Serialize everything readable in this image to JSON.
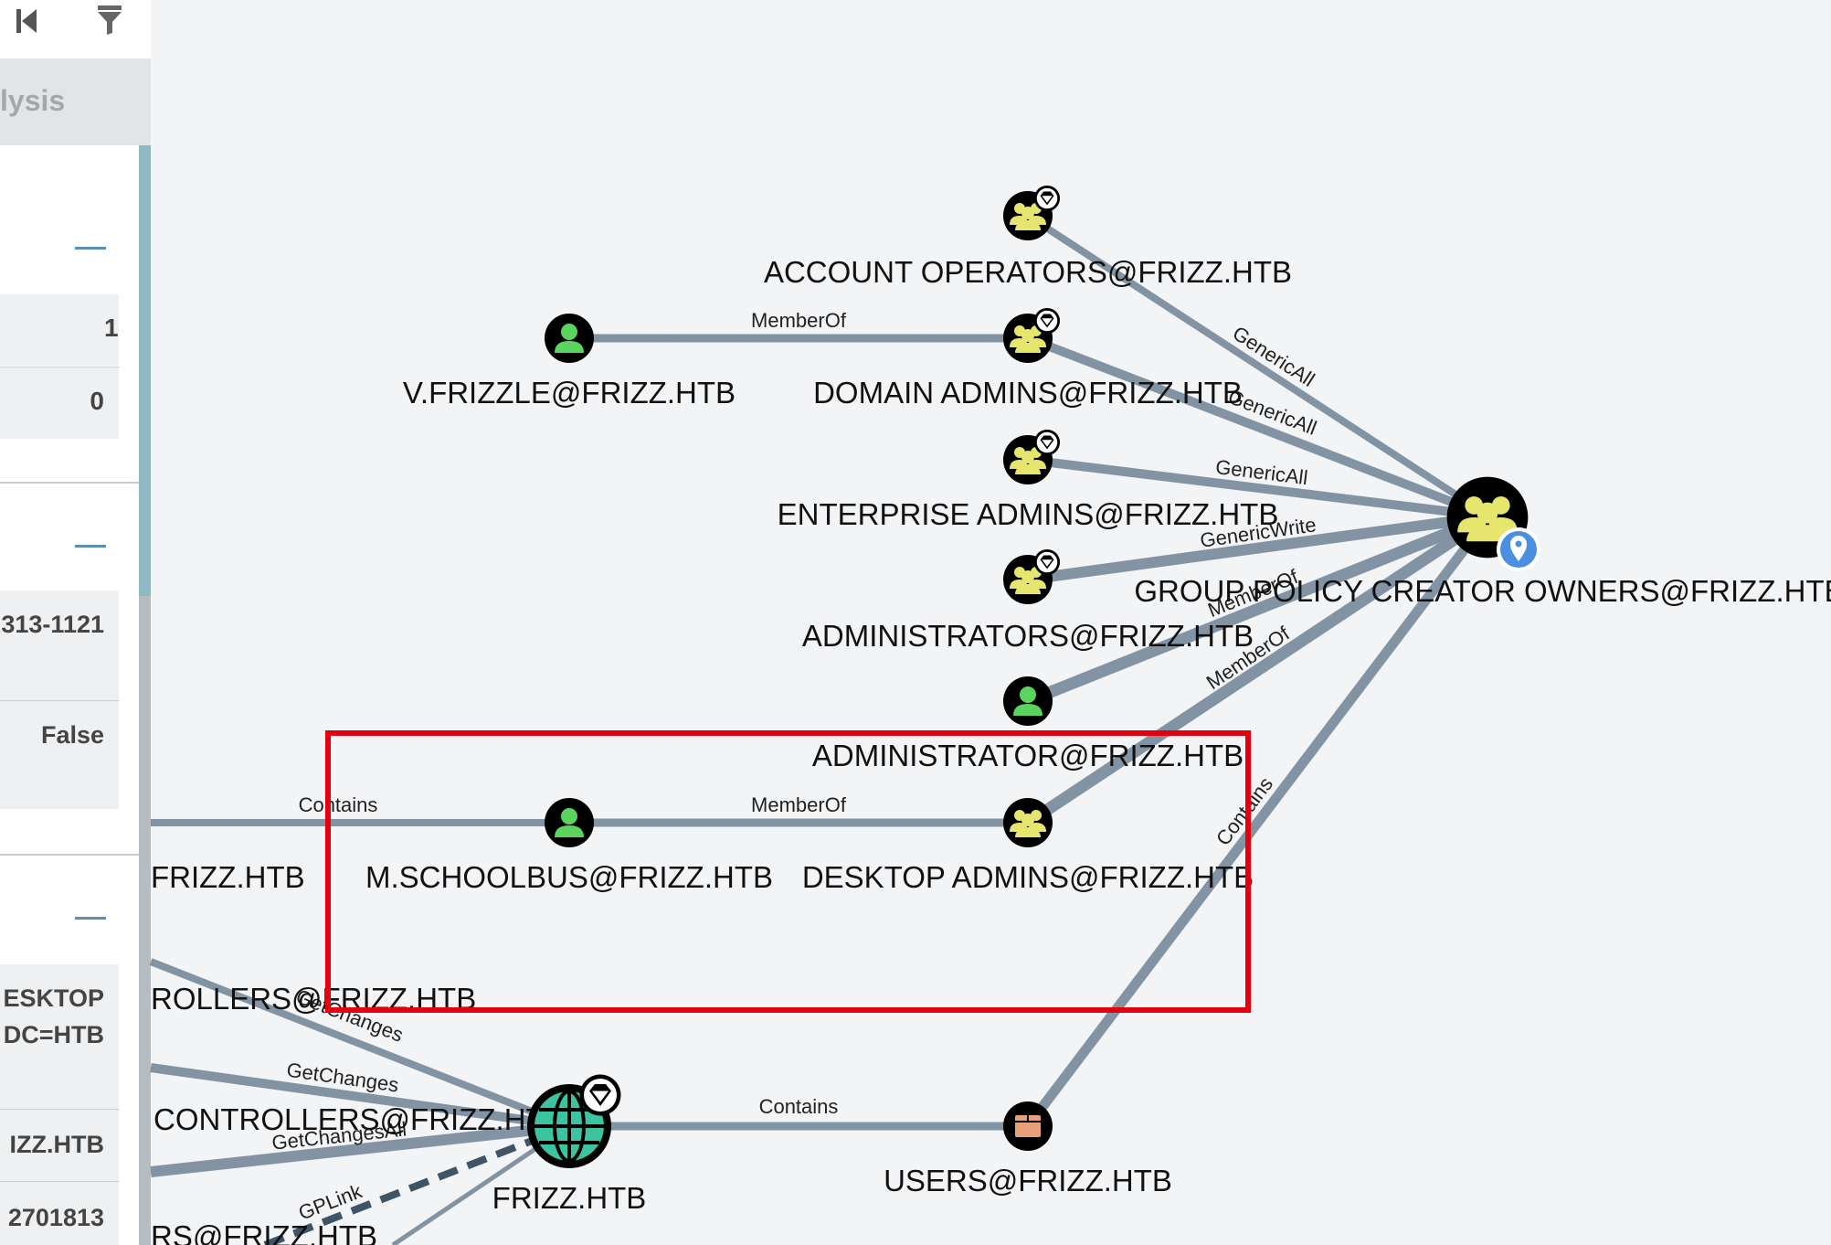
{
  "panel": {
    "tab_label": "lysis",
    "rows": [
      "1",
      "0",
      "313-1121",
      "False",
      "ESKTOP",
      "DC=HTB",
      "IZZ.HTB",
      "2701813"
    ]
  },
  "graph": {
    "nodes": {
      "account_operators": "ACCOUNT OPERATORS@FRIZZ.HTB",
      "v_frizzle": "V.FRIZZLE@FRIZZ.HTB",
      "domain_admins": "DOMAIN ADMINS@FRIZZ.HTB",
      "enterprise_admins": "ENTERPRISE ADMINS@FRIZZ.HTB",
      "administrators": "ADMINISTRATORS@FRIZZ.HTB",
      "gpo_creator_owners": "GROUP POLICY CREATOR OWNERS@FRIZZ.HTB",
      "administrator": "ADMINISTRATOR@FRIZZ.HTB",
      "m_schoolbus": "M.SCHOOLBUS@FRIZZ.HTB",
      "desktop_admins": "DESKTOP ADMINS@FRIZZ.HTB",
      "frizz_ou_partial": "FRIZZ.HTB",
      "controllers_partial_1": "ROLLERS@FRIZZ.HTB",
      "controllers_partial_2": "CONTROLLERS@FRIZZ.HTB",
      "frizz_domain": "FRIZZ.HTB",
      "users": "USERS@FRIZZ.HTB",
      "bottom_partial": "RS@FRIZZ.HTB"
    },
    "edges": {
      "vfrizzle_memberof": "MemberOf",
      "account_ops_genericall": "GenericAll",
      "domain_admins_genericall": "GenericAll",
      "enterprise_admins_genericall": "GenericAll",
      "administrators_genericwrite": "GenericWrite",
      "administrator_memberof": "MemberOf",
      "desktop_admins_memberof": "MemberOf",
      "users_contains": "Contains",
      "ou_contains": "Contains",
      "schoolbus_memberof": "MemberOf",
      "getchanges_1": "GetChanges",
      "getchanges_2": "GetChanges",
      "getchangesall": "GetChangesAll",
      "gplink": "GPLink",
      "domain_contains_users": "Contains"
    },
    "highlight_color": "#e3000f",
    "user_icon_color": "#5bd45d",
    "group_icon_color": "#e6e66e",
    "domain_icon_color": "#3cc4a0",
    "container_icon_color": "#e8a07a"
  }
}
